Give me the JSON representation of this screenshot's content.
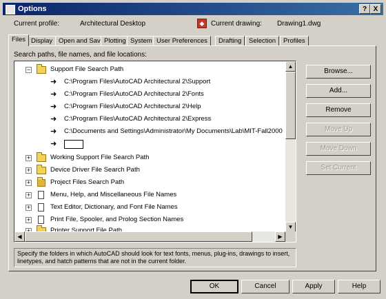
{
  "window": {
    "title": "Options",
    "help_button": "?",
    "close_button": "X"
  },
  "profile_bar": {
    "current_profile_label": "Current profile:",
    "current_profile_value": "Architectural Desktop",
    "current_drawing_label": "Current drawing:",
    "current_drawing_value": "Drawing1.dwg"
  },
  "tabs": [
    {
      "label": "Files",
      "active": true
    },
    {
      "label": "Display",
      "active": false
    },
    {
      "label": "Open and Save",
      "active": false
    },
    {
      "label": "Plotting",
      "active": false
    },
    {
      "label": "System",
      "active": false
    },
    {
      "label": "User Preferences",
      "active": false
    },
    {
      "label": "Drafting",
      "active": false
    },
    {
      "label": "Selection",
      "active": false
    },
    {
      "label": "Profiles",
      "active": false
    }
  ],
  "files_tab": {
    "section_label": "Search paths, file names, and file locations:",
    "tree": {
      "support_root": {
        "label": "Support File Search Path",
        "expanded": true
      },
      "support_paths": [
        "C:\\Program Files\\AutoCAD Architectural 2\\Support",
        "C:\\Program Files\\AutoCAD Architectural 2\\Fonts",
        "C:\\Program Files\\AutoCAD Architectural 2\\Help",
        "C:\\Program Files\\AutoCAD Architectural 2\\Express",
        "C:\\Documents and Settings\\Administrator\\My Documents\\Lab\\MIT-Fall2000"
      ],
      "other_nodes": [
        {
          "label": "Working Support File Search Path",
          "icon": "folder-icon"
        },
        {
          "label": "Device Driver File Search Path",
          "icon": "folder-icon"
        },
        {
          "label": "Project Files Search Path",
          "icon": "project-icon"
        },
        {
          "label": "Menu, Help, and Miscellaneous File Names",
          "icon": "document-icon"
        },
        {
          "label": "Text Editor, Dictionary, and Font File Names",
          "icon": "document-icon"
        },
        {
          "label": "Print File, Spooler, and Prolog Section Names",
          "icon": "document-icon"
        },
        {
          "label": "Printer Support File Path",
          "icon": "folder-icon"
        }
      ]
    },
    "description": "Specify the folders in which AutoCAD should look for text fonts, menus, plug-ins, drawings to insert, linetypes, and hatch patterns that are not in the current folder.",
    "side_buttons": {
      "browse": "Browse...",
      "add": "Add...",
      "remove": "Remove",
      "move_up": "Move Up",
      "move_down": "Move Down",
      "set_current": "Set Current"
    }
  },
  "dialog_buttons": {
    "ok": "OK",
    "cancel": "Cancel",
    "apply": "Apply",
    "help": "Help"
  }
}
